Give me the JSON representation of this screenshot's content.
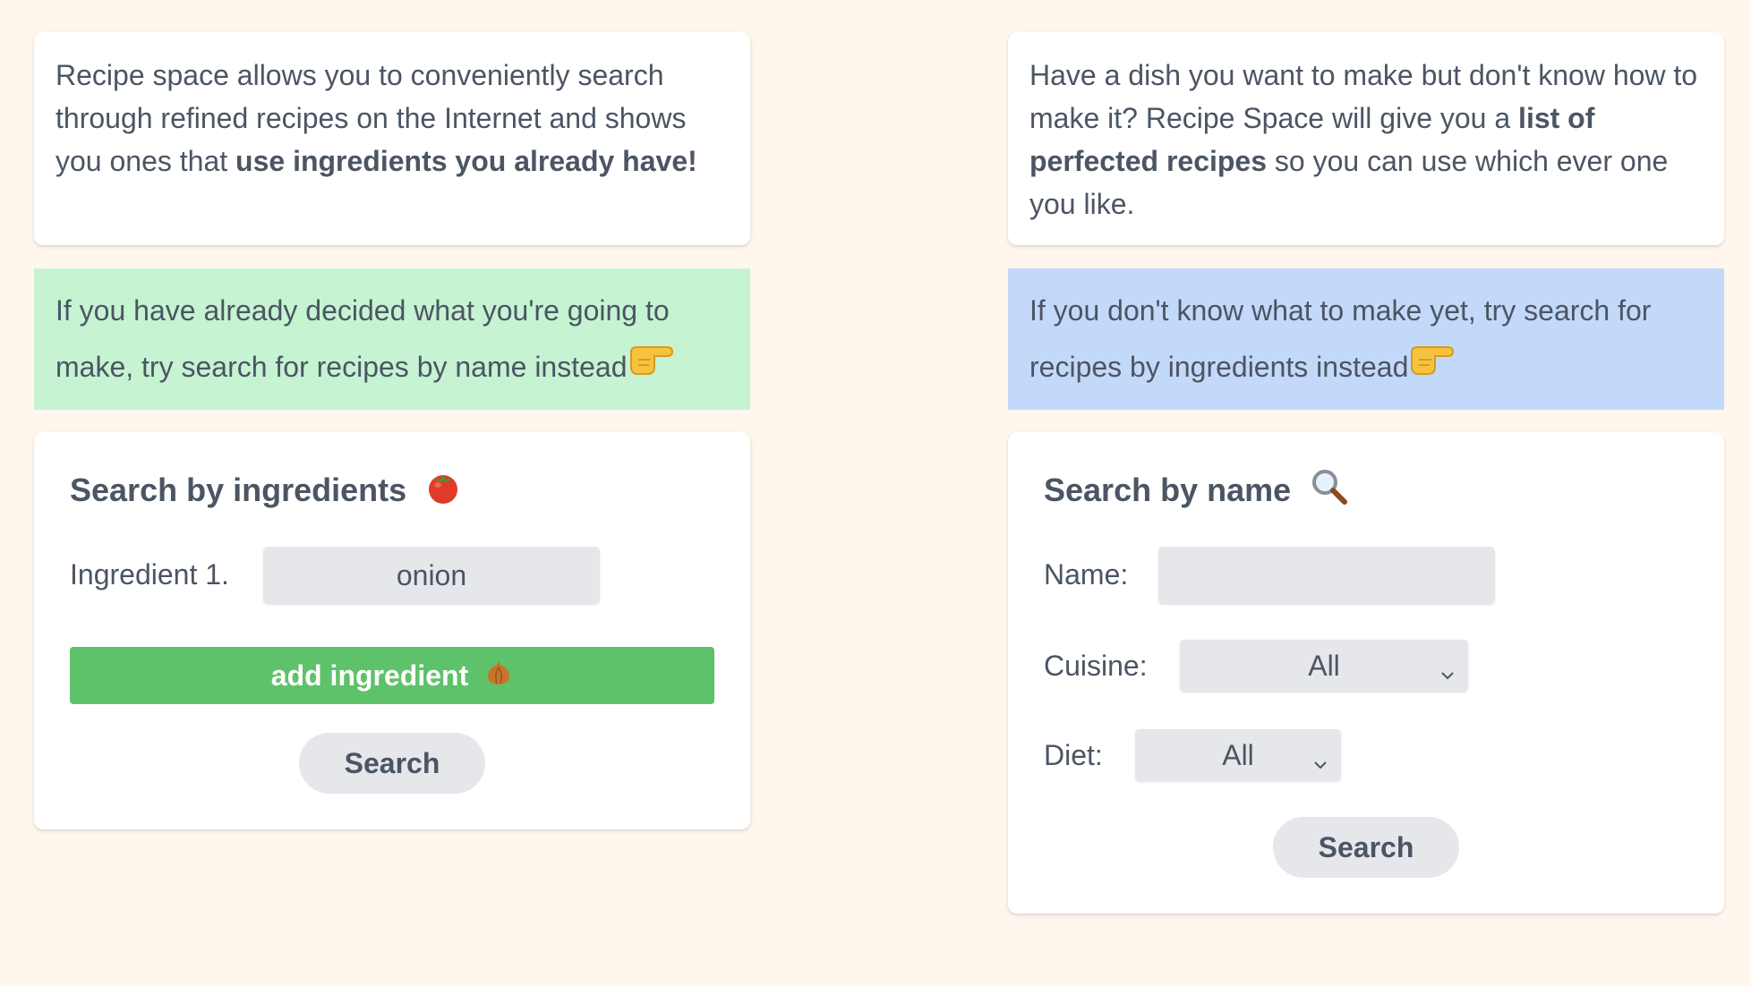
{
  "left_intro": {
    "text_a": "Recipe space allows you to conveniently search through refined recipes on the Internet and shows you ones that ",
    "text_b": "use ingredients you already have!"
  },
  "right_intro": {
    "text_a": "Have a dish you want to make but don't know how to make it? Recipe Space will give you a ",
    "text_b": "list of perfected recipes",
    "text_c": " so you can use which ever one you like."
  },
  "left_tip": {
    "text": "If you have already decided what you're going to make, try search for recipes by name instead"
  },
  "right_tip": {
    "text": "If you don't know what to make yet, try search for recipes by ingredients instead"
  },
  "ingredients_form": {
    "title": "Search by ingredients",
    "title_icon": "tomato-icon",
    "ingredient_label": "Ingredient 1.",
    "ingredient_value": "onion",
    "add_label": "add ingredient",
    "add_icon": "onion-icon",
    "search_label": "Search"
  },
  "name_form": {
    "title": "Search by name",
    "title_icon": "magnifier-icon",
    "name_label": "Name:",
    "name_value": "",
    "cuisine_label": "Cuisine:",
    "cuisine_value": "All",
    "diet_label": "Diet:",
    "diet_value": "All",
    "search_label": "Search"
  },
  "colors": {
    "background": "#fff6ee",
    "tip_green": "#c6f3d2",
    "tip_blue": "#c3d9f9",
    "add_button": "#5ec26a",
    "input_bg": "#e5e7eb",
    "text": "#4b5563"
  }
}
